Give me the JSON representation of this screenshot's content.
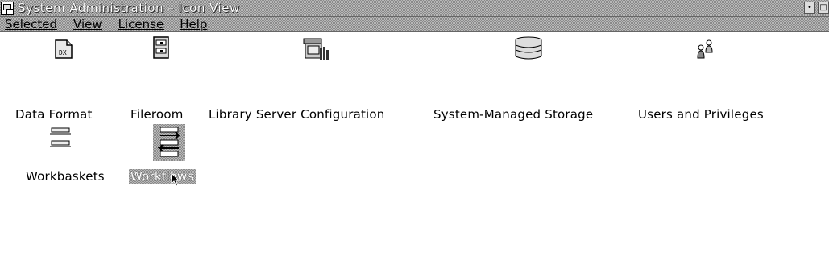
{
  "window": {
    "title": "System Administration – Icon View"
  },
  "menubar": {
    "items": [
      "Selected",
      "View",
      "License",
      "Help"
    ]
  },
  "icons": [
    {
      "label": "Data Format",
      "icon": "data-format-icon"
    },
    {
      "label": "Fileroom",
      "icon": "fileroom-icon"
    },
    {
      "label": "Library Server Configuration",
      "icon": "library-server-icon"
    },
    {
      "label": "System-Managed Storage",
      "icon": "storage-icon"
    },
    {
      "label": "Users and Privileges",
      "icon": "users-icon"
    },
    {
      "label": "Workbaskets",
      "icon": "workbaskets-icon"
    },
    {
      "label": "Workflows",
      "icon": "workflows-icon",
      "selected": true
    }
  ]
}
